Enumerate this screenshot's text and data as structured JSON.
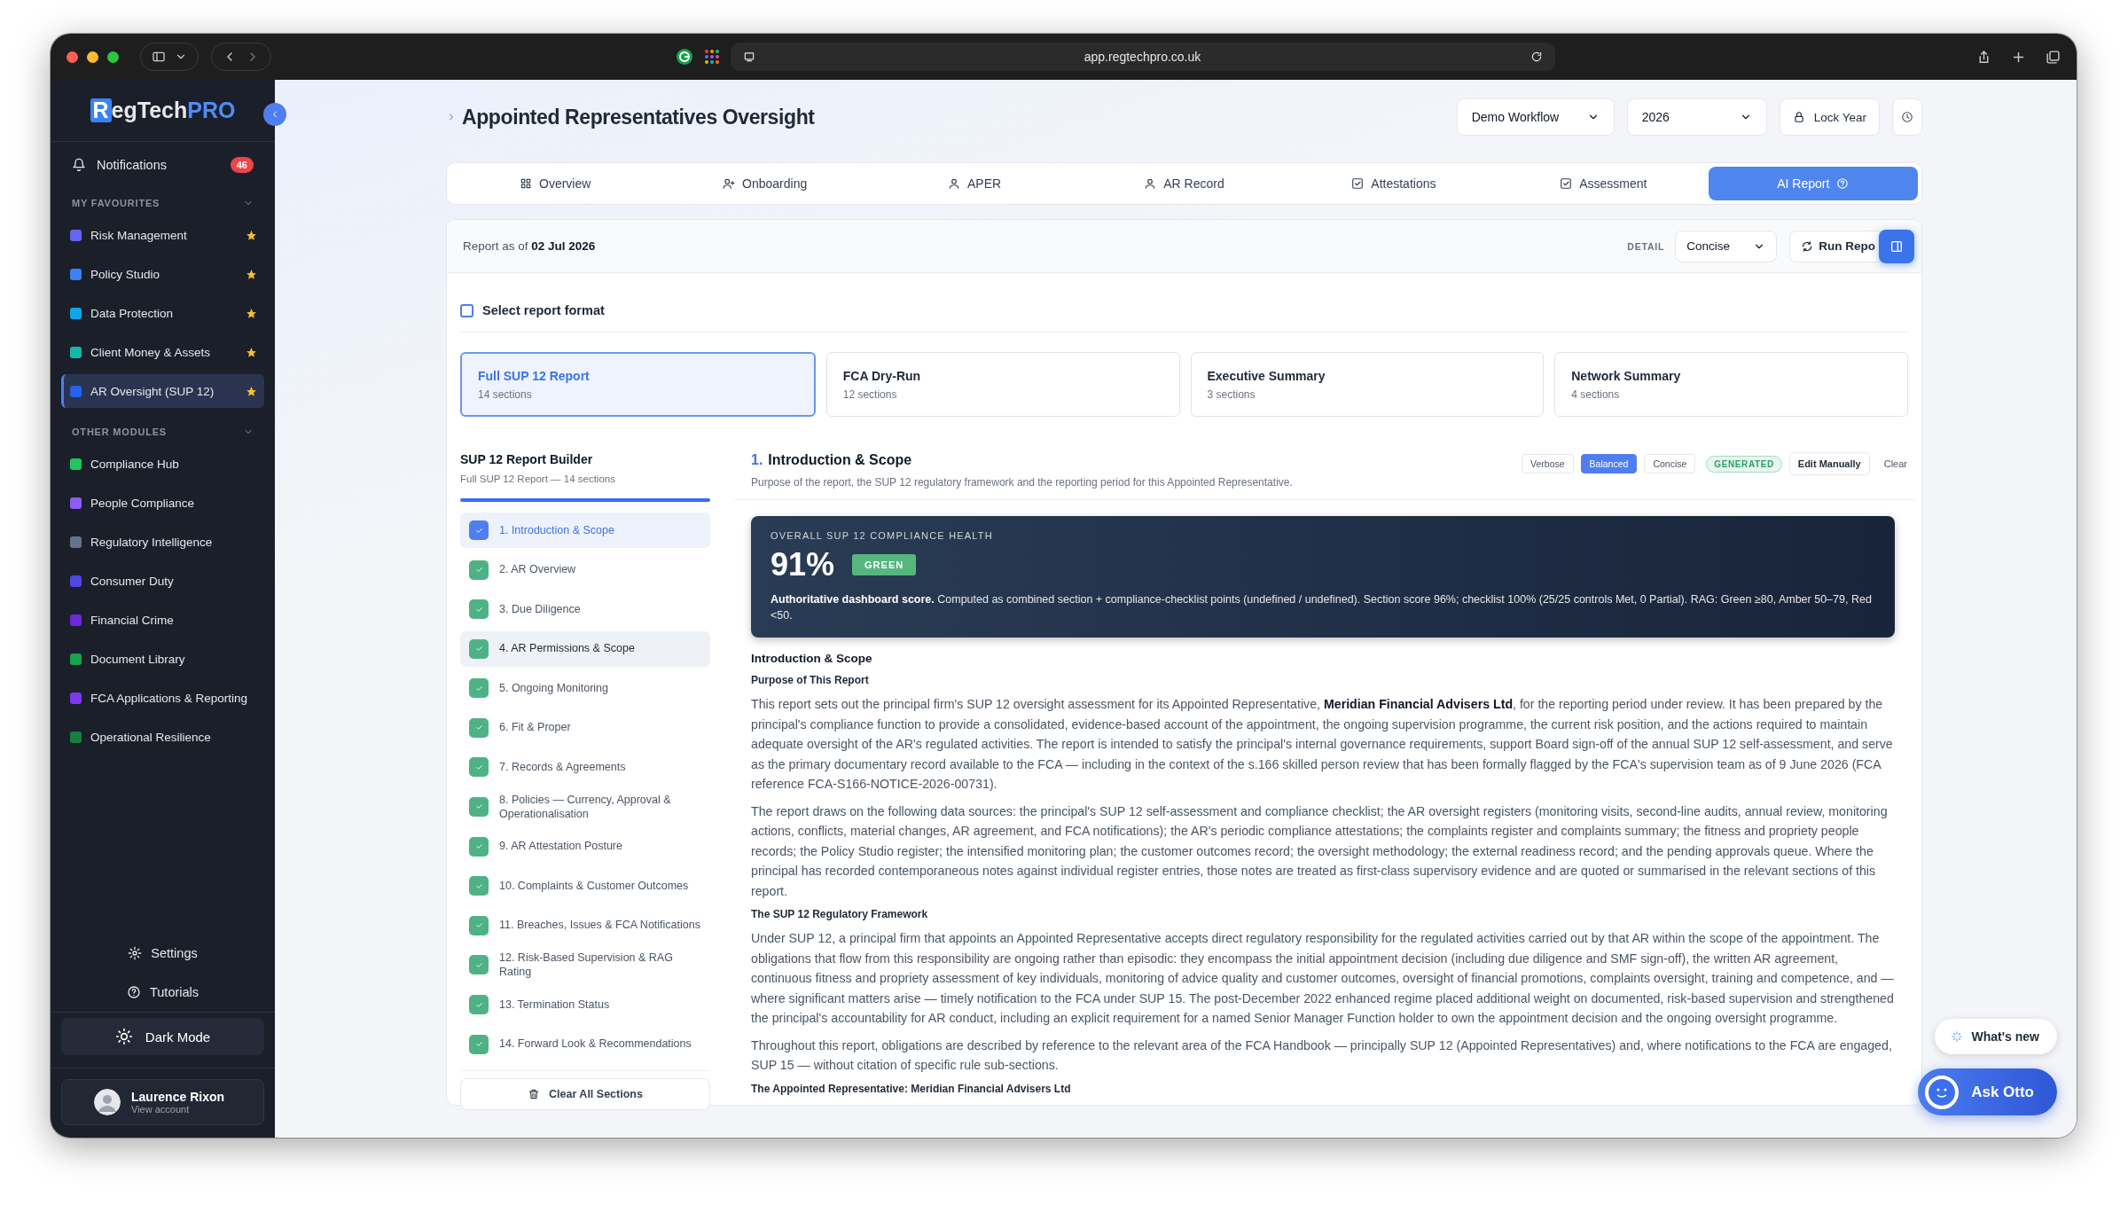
{
  "browser": {
    "url": "app.regtechpro.co.uk"
  },
  "sidebar": {
    "logo": {
      "letter": "R",
      "text": "egTech",
      "accent": "PRO"
    },
    "notifications": {
      "label": "Notifications",
      "count": "46"
    },
    "groups": [
      {
        "title": "MY FAVOURITES",
        "expanded": true,
        "items": [
          {
            "label": "Risk Management",
            "selected": false,
            "favourite": true,
            "color": "#6366f1"
          },
          {
            "label": "Policy Studio",
            "selected": false,
            "favourite": true,
            "color": "#3b82f6"
          },
          {
            "label": "Data Protection",
            "selected": false,
            "favourite": true,
            "color": "#0ea5e9"
          },
          {
            "label": "Client Money & Assets",
            "selected": false,
            "favourite": true,
            "color": "#14b8a6"
          },
          {
            "label": "AR Oversight (SUP 12)",
            "selected": true,
            "favourite": true,
            "color": "#2563eb"
          }
        ]
      },
      {
        "title": "OTHER MODULES",
        "expanded": true,
        "items": [
          {
            "label": "Compliance Hub",
            "selected": false,
            "favourite": false,
            "color": "#22c55e"
          },
          {
            "label": "People Compliance",
            "selected": false,
            "favourite": false,
            "color": "#8b5cf6"
          },
          {
            "label": "Regulatory Intelligence",
            "selected": false,
            "favourite": false,
            "color": "#64748b"
          },
          {
            "label": "Consumer Duty",
            "selected": false,
            "favourite": false,
            "color": "#4f46e5"
          },
          {
            "label": "Financial Crime",
            "selected": false,
            "favourite": false,
            "color": "#6d28d9"
          },
          {
            "label": "Document Library",
            "selected": false,
            "favourite": false,
            "color": "#16a34a"
          },
          {
            "label": "FCA Applications & Reporting",
            "selected": false,
            "favourite": false,
            "color": "#7c3aed"
          },
          {
            "label": "Operational Resilience",
            "selected": false,
            "favourite": false,
            "color": "#15803d"
          }
        ]
      }
    ],
    "settings": "Settings",
    "tutorials": "Tutorials",
    "dark_mode": "Dark Mode",
    "user": {
      "name": "Laurence Rixon",
      "subtitle": "View account"
    }
  },
  "header": {
    "title": "Appointed Representatives Oversight",
    "workflow": "Demo Workflow",
    "year": "2026",
    "lock": "Lock Year"
  },
  "tabs": [
    {
      "label": "Overview",
      "kind": "grid",
      "selected": false
    },
    {
      "label": "Onboarding",
      "kind": "user-add",
      "selected": false
    },
    {
      "label": "APER",
      "kind": "user",
      "selected": false
    },
    {
      "label": "AR Record",
      "kind": "user",
      "selected": false
    },
    {
      "label": "Attestations",
      "kind": "check",
      "selected": false
    },
    {
      "label": "Assessment",
      "kind": "check",
      "selected": false
    },
    {
      "label": "AI Report",
      "kind": "help",
      "selected": true
    }
  ],
  "report": {
    "as_of_label": "Report as of",
    "as_of_date": "02 Jul 2026",
    "detail_label": "DETAIL",
    "detail_value": "Concise",
    "run_label": "Run Repo"
  },
  "format": {
    "label": "Select report format",
    "checked": false,
    "cards": [
      {
        "title": "Full SUP 12 Report",
        "subtitle": "14 sections",
        "selected": true
      },
      {
        "title": "FCA Dry-Run",
        "subtitle": "12 sections",
        "selected": false
      },
      {
        "title": "Executive Summary",
        "subtitle": "3 sections",
        "selected": false
      },
      {
        "title": "Network Summary",
        "subtitle": "4 sections",
        "selected": false
      }
    ]
  },
  "builder": {
    "title": "SUP 12 Report Builder",
    "subtitle": "Full SUP 12 Report — 14 sections",
    "level": 1,
    "clear": "Clear All Sections",
    "sections": [
      {
        "label": "1. Introduction & Scope",
        "checked": true,
        "selected": true,
        "hovered": false
      },
      {
        "label": "2. AR Overview",
        "checked": true,
        "selected": false,
        "hovered": false
      },
      {
        "label": "3. Due Diligence",
        "checked": true,
        "selected": false,
        "hovered": false
      },
      {
        "label": "4. AR Permissions & Scope",
        "checked": true,
        "selected": false,
        "hovered": true
      },
      {
        "label": "5. Ongoing Monitoring",
        "checked": true,
        "selected": false,
        "hovered": false
      },
      {
        "label": "6. Fit & Proper",
        "checked": true,
        "selected": false,
        "hovered": false
      },
      {
        "label": "7. Records & Agreements",
        "checked": true,
        "selected": false,
        "hovered": false
      },
      {
        "label": "8. Policies — Currency, Approval & Operationalisation",
        "checked": true,
        "selected": false,
        "hovered": false
      },
      {
        "label": "9. AR Attestation Posture",
        "checked": true,
        "selected": false,
        "hovered": false
      },
      {
        "label": "10. Complaints & Customer Outcomes",
        "checked": true,
        "selected": false,
        "hovered": false
      },
      {
        "label": "11. Breaches, Issues & FCA Notifications",
        "checked": true,
        "selected": false,
        "hovered": false
      },
      {
        "label": "12. Risk-Based Supervision & RAG Rating",
        "checked": true,
        "selected": false,
        "hovered": false
      },
      {
        "label": "13. Termination Status",
        "checked": true,
        "selected": false,
        "hovered": false
      },
      {
        "label": "14. Forward Look & Recommendations",
        "checked": true,
        "selected": false,
        "hovered": false
      }
    ]
  },
  "section": {
    "number": "1.",
    "title": "Introduction & Scope",
    "description": "Purpose of the report, the SUP 12 regulatory framework and the reporting period for this Appointed Representative.",
    "modes": [
      {
        "label": "Verbose",
        "selected": false
      },
      {
        "label": "Balanced",
        "selected": true
      },
      {
        "label": "Concise",
        "selected": false
      }
    ],
    "status": "GENERATED",
    "edit": "Edit Manually",
    "clear": "Clear"
  },
  "health": {
    "label": "OVERALL SUP 12 COMPLIANCE HEALTH",
    "score": "91%",
    "rag": "GREEN",
    "note": "**Authoritative dashboard score.** Computed as combined section + compliance-checklist points (undefined / undefined). Section score 96%; checklist 100% (25/25 controls Met, 0 Partial). RAG: Green ≥80, Amber 50–79, Red <50."
  },
  "body": [
    {
      "kind": "heading",
      "text": "Introduction & Scope"
    },
    {
      "kind": "subheading",
      "text": "Purpose of This Report"
    },
    {
      "kind": "paragraph",
      "text": "This report sets out the principal firm's SUP 12 oversight assessment for its Appointed Representative, **Meridian Financial Advisers Ltd**, for the reporting period under review. It has been prepared by the principal's compliance function to provide a consolidated, evidence-based account of the appointment, the ongoing supervision programme, the current risk position, and the actions required to maintain adequate oversight of the AR's regulated activities. The report is intended to satisfy the principal's internal governance requirements, support Board sign-off of the annual SUP 12 self-assessment, and serve as the primary documentary record available to the FCA — including in the context of the s.166 skilled person review that has been formally flagged by the FCA's supervision team as of 9 June 2026 (FCA reference FCA-S166-NOTICE-2026-00731)."
    },
    {
      "kind": "paragraph",
      "text": "The report draws on the following data sources: the principal's SUP 12 self-assessment and compliance checklist; the AR oversight registers (monitoring visits, second-line audits, annual review, monitoring actions, conflicts, material changes, AR agreement, and FCA notifications); the AR's periodic compliance attestations; the complaints register and complaints summary; the fitness and propriety people records; the Policy Studio register; the intensified monitoring plan; the customer outcomes record; the oversight methodology; the external readiness record; and the pending approvals queue. Where the principal has recorded contemporaneous notes against individual register entries, those notes are treated as first-class supervisory evidence and are quoted or summarised in the relevant sections of this report."
    },
    {
      "kind": "subheading",
      "text": "The SUP 12 Regulatory Framework"
    },
    {
      "kind": "paragraph",
      "text": "Under SUP 12, a principal firm that appoints an Appointed Representative accepts direct regulatory responsibility for the regulated activities carried out by that AR within the scope of the appointment. The obligations that flow from this responsibility are ongoing rather than episodic: they encompass the initial appointment decision (including due diligence and SMF sign-off), the written AR agreement, continuous fitness and propriety assessment of key individuals, monitoring of advice quality and customer outcomes, oversight of financial promotions, complaints oversight, training and competence, and — where significant matters arise — timely notification to the FCA under SUP 15. The post-December 2022 enhanced regime placed additional weight on documented, risk-based supervision and strengthened the principal's accountability for AR conduct, including an explicit requirement for a named Senior Manager Function holder to own the appointment decision and the ongoing oversight programme."
    },
    {
      "kind": "paragraph",
      "text": "Throughout this report, obligations are described by reference to the relevant area of the FCA Handbook — principally SUP 12 (Appointed Representatives) and, where notifications to the FCA are engaged, SUP 15 — without citation of specific rule sub-sections."
    },
    {
      "kind": "subheading",
      "text": "The Appointed Representative: Meridian Financial Advisers Ltd"
    }
  ],
  "floating": {
    "whats_new": "What's new",
    "ask": "Ask Otto"
  }
}
